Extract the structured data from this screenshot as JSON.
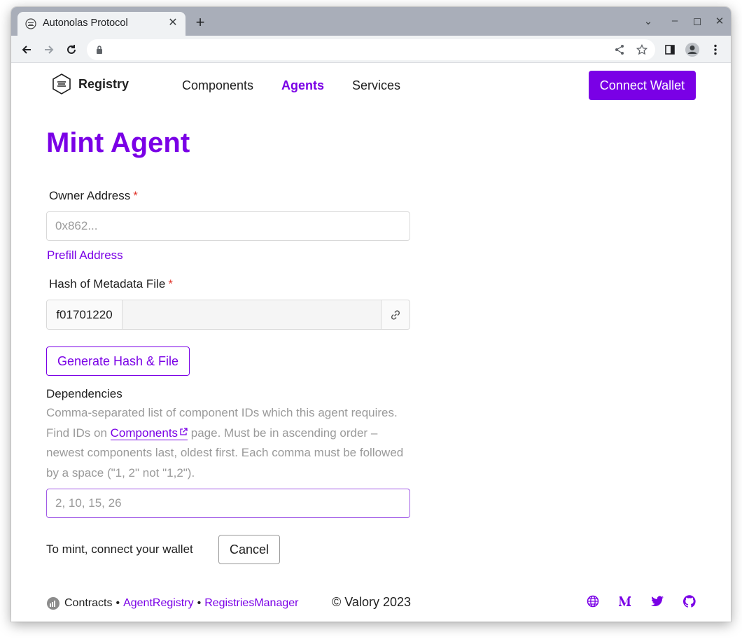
{
  "browser": {
    "tab_title": "Autonolas Protocol",
    "tab_close": "✕",
    "new_tab": "+",
    "window_controls": [
      "⌄",
      "–",
      "◻",
      "✕"
    ]
  },
  "nav": {
    "brand": "Registry",
    "items": [
      {
        "label": "Components",
        "active": false
      },
      {
        "label": "Agents",
        "active": true
      },
      {
        "label": "Services",
        "active": false
      }
    ],
    "connect_wallet": "Connect Wallet"
  },
  "form": {
    "title": "Mint Agent",
    "owner_label": "Owner Address",
    "required_mark": "*",
    "owner_placeholder": "0x862...",
    "prefill_link": "Prefill Address",
    "hash_label": "Hash of Metadata File",
    "hash_prefix": "f01701220",
    "hash_value": "",
    "generate_button": "Generate Hash & File",
    "dependencies_label": "Dependencies",
    "help_part1": "Comma-separated list of component IDs which this agent requires. Find IDs on ",
    "help_link": "Components",
    "help_part2": " page. Must be in ascending order – newest components last, oldest first. Each comma must be followed by a space (\"1, 2\" not \"1,2\").",
    "dependencies_placeholder": "2, 10, 15, 26",
    "mint_note": "To mint, connect your wallet",
    "cancel_button": "Cancel"
  },
  "footer": {
    "contracts_label": "Contracts",
    "separator": "•",
    "links": [
      "AgentRegistry",
      "RegistriesManager"
    ],
    "copyright": "© Valory 2023",
    "social_icons": [
      "globe-icon",
      "medium-icon",
      "twitter-icon",
      "github-icon"
    ]
  },
  "colors": {
    "accent": "#7a00e6",
    "required": "#e0352b",
    "muted_text": "#9a9a9a"
  }
}
